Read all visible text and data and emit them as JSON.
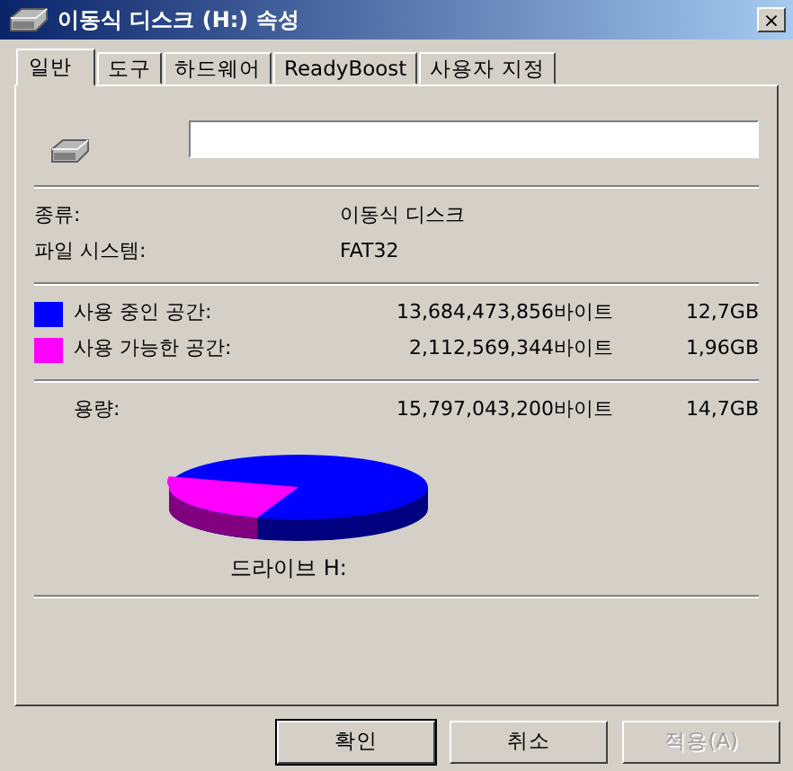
{
  "window": {
    "title": "이동식 디스크 (H:) 속성",
    "close": "×"
  },
  "tabs": [
    {
      "label": "일반",
      "selected": true
    },
    {
      "label": "도구",
      "selected": false
    },
    {
      "label": "하드웨어",
      "selected": false
    },
    {
      "label": "ReadyBoost",
      "selected": false
    },
    {
      "label": "사용자 지정",
      "selected": false
    }
  ],
  "info": [
    {
      "label": "종류:",
      "value": "이동식 디스크"
    },
    {
      "label": "파일 시스템:",
      "value": "FAT32"
    }
  ],
  "space": [
    {
      "label": "사용 중인 공간:",
      "bytes": "13,684,473,856바이트",
      "size": "12,7GB",
      "color": "#0000ff"
    },
    {
      "label": "사용 가능한 공간:",
      "bytes": "2,112,569,344바이트",
      "size": "1,96GB",
      "color": "#ff00ff"
    }
  ],
  "capacity": {
    "label": "용량:",
    "bytes": "15,797,043,200바이트",
    "size": "14,7GB"
  },
  "drive_label": "드라이브 H:",
  "buttons": [
    {
      "label": "확인",
      "disabled": false,
      "default": true
    },
    {
      "label": "취소",
      "disabled": false,
      "default": false
    },
    {
      "label": "적용(A)",
      "disabled": true,
      "default": false
    }
  ]
}
